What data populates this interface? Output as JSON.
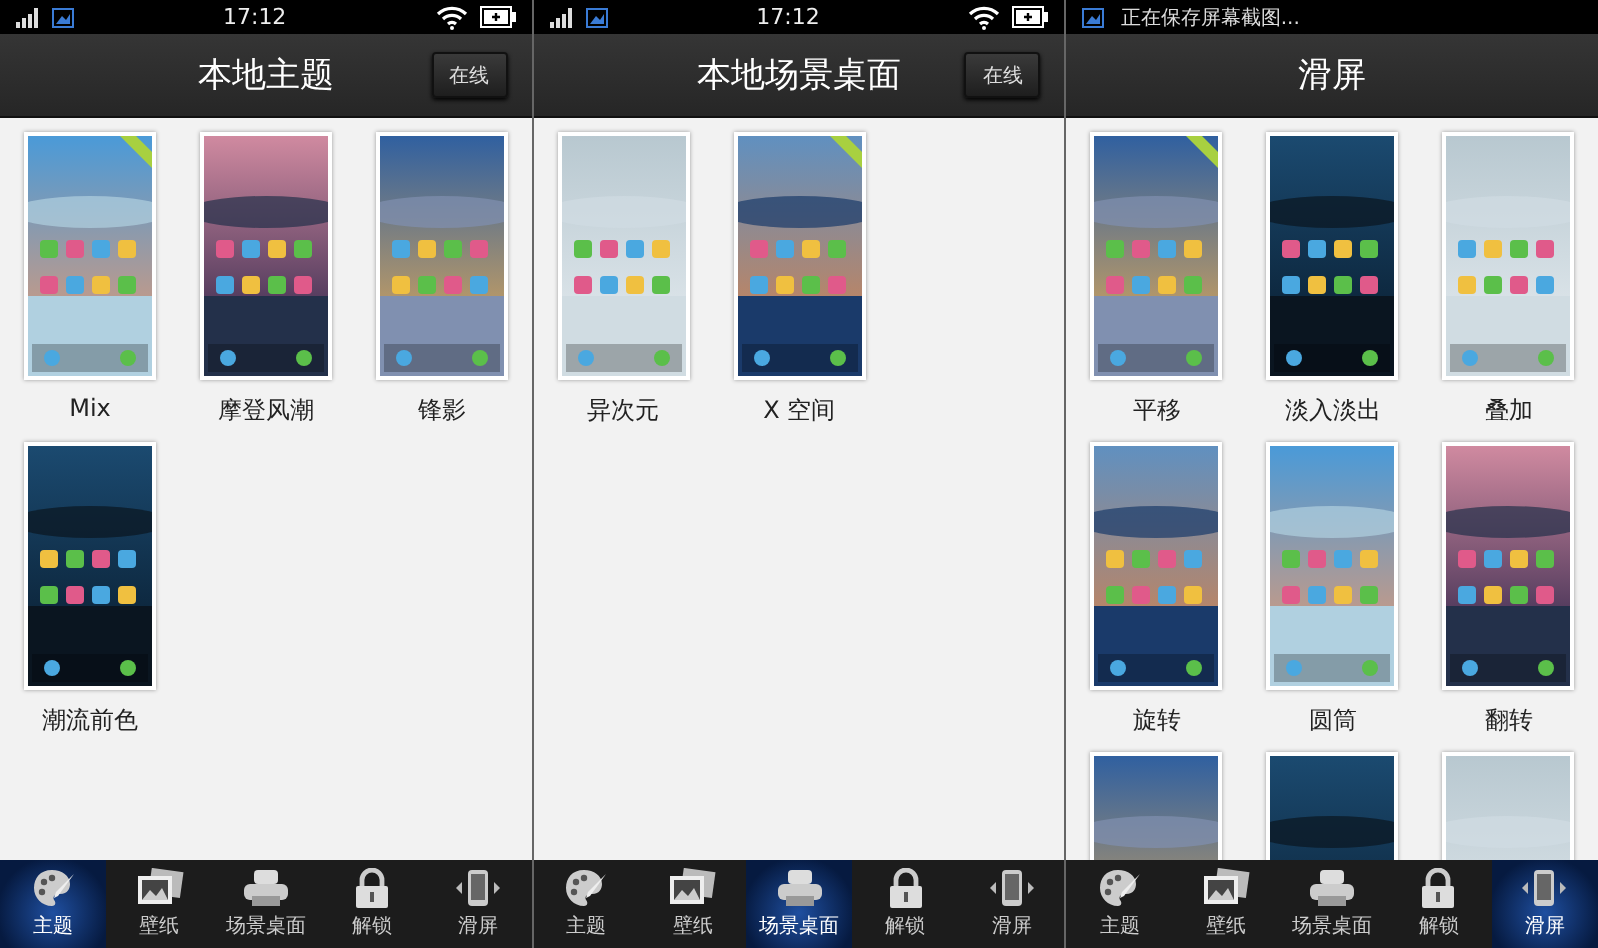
{
  "screens": [
    {
      "status_bar": {
        "time": "17:12"
      },
      "title": "本地主题",
      "online_button": "在线",
      "items": [
        {
          "label": "Mix",
          "in_use": true
        },
        {
          "label": "摩登风潮",
          "in_use": false
        },
        {
          "label": "锋影",
          "in_use": false
        },
        {
          "label": "潮流前色",
          "in_use": false
        }
      ],
      "tabs": [
        {
          "label": "主题",
          "selected": true
        },
        {
          "label": "壁纸",
          "selected": false
        },
        {
          "label": "场景桌面",
          "selected": false
        },
        {
          "label": "解锁",
          "selected": false
        },
        {
          "label": "滑屏",
          "selected": false
        }
      ]
    },
    {
      "status_bar": {
        "time": "17:12"
      },
      "title": "本地场景桌面",
      "online_button": "在线",
      "items": [
        {
          "label": "异次元",
          "in_use": false
        },
        {
          "label": "X 空间",
          "in_use": true
        }
      ],
      "tabs": [
        {
          "label": "主题",
          "selected": false
        },
        {
          "label": "壁纸",
          "selected": false
        },
        {
          "label": "场景桌面",
          "selected": true
        },
        {
          "label": "解锁",
          "selected": false
        },
        {
          "label": "滑屏",
          "selected": false
        }
      ]
    },
    {
      "status_bar": {
        "notification": "正在保存屏幕截图..."
      },
      "title": "滑屏",
      "items": [
        {
          "label": "平移",
          "in_use": true
        },
        {
          "label": "淡入淡出",
          "in_use": false
        },
        {
          "label": "叠加",
          "in_use": false
        },
        {
          "label": "旋转",
          "in_use": false
        },
        {
          "label": "圆筒",
          "in_use": false
        },
        {
          "label": "翻转",
          "in_use": false
        },
        {
          "in_use": false
        },
        {
          "in_use": false
        },
        {
          "in_use": false
        }
      ],
      "tabs": [
        {
          "label": "主题",
          "selected": false
        },
        {
          "label": "壁纸",
          "selected": false
        },
        {
          "label": "场景桌面",
          "selected": false
        },
        {
          "label": "解锁",
          "selected": false
        },
        {
          "label": "滑屏",
          "selected": true
        }
      ]
    }
  ]
}
